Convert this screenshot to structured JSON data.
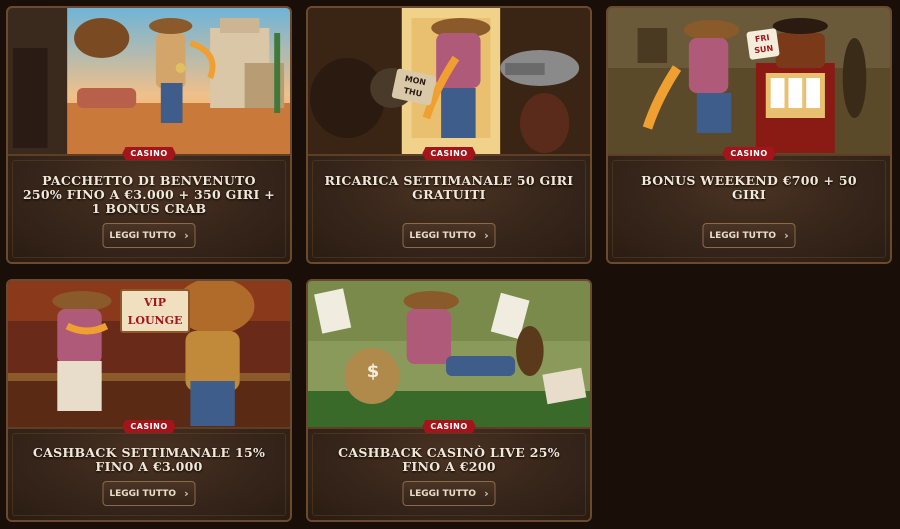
{
  "cards": [
    {
      "badge": "CASINO",
      "title": "PACCHETTO DI BENVENUTO 250% FINO A €3.000 + 350 GIRI + 1 BONUS CRAB",
      "button": "LEGGI TUTTO",
      "art_theme": "western-street",
      "art_text": ""
    },
    {
      "badge": "CASINO",
      "title": "RICARICA SETTIMANALE 50 GIRI GRATUITI",
      "button": "LEGGI TUTTO",
      "art_theme": "saloon-door-revolver",
      "art_text": "MON THU"
    },
    {
      "badge": "CASINO",
      "title": "BONUS WEEKEND €700 + 50 GIRI",
      "button": "LEGGI TUTTO",
      "art_theme": "slot-machine",
      "art_text": "FRI SUN"
    },
    {
      "badge": "CASINO",
      "title": "CASHBACK SETTIMANALE 15% FINO A €3.000",
      "button": "LEGGI TUTTO",
      "art_theme": "vip-lounge-bar",
      "art_text": "VIP LOUNGE"
    },
    {
      "badge": "CASINO",
      "title": "CASHBACK CASINÒ LIVE 25% FINO A €200",
      "button": "LEGGI TUTTO",
      "art_theme": "card-table-money",
      "art_text": "$"
    }
  ],
  "colors": {
    "page_bg": "#1a0f08",
    "panel": "#35241a",
    "badge_red": "#a3151a",
    "text": "#f2e8d8",
    "border": "#6b4a2e"
  }
}
